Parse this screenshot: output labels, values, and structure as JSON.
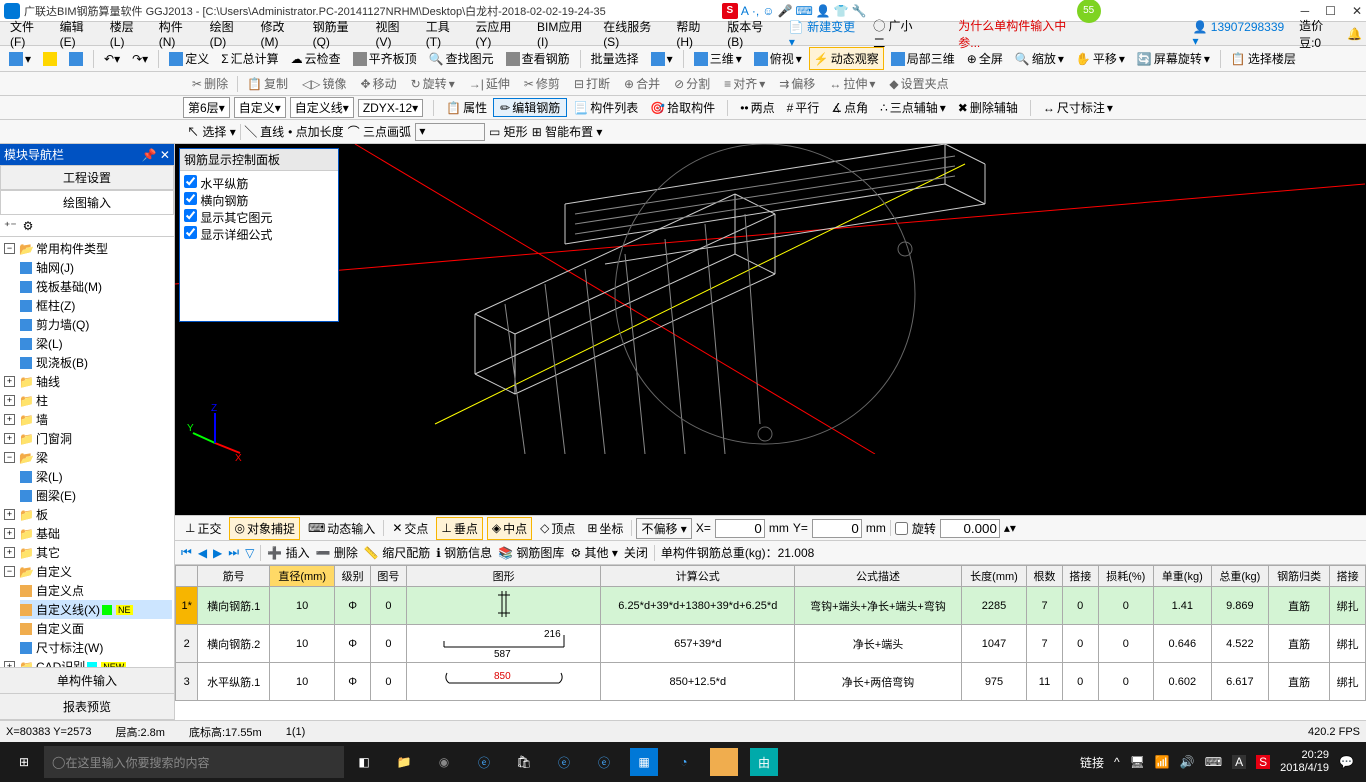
{
  "title": "广联达BIM钢筋算量软件 GGJ2013 - [C:\\Users\\Administrator.PC-20141127NRHM\\Desktop\\白龙村-2018-02-02-19-24-35",
  "green_badge": "55",
  "menubar": [
    "文件(F)",
    "编辑(E)",
    "楼层(L)",
    "构件(N)",
    "绘图(D)",
    "修改(M)",
    "钢筋量(Q)",
    "视图(V)",
    "工具(T)",
    "云应用(Y)",
    "BIM应用(I)",
    "在线服务(S)",
    "帮助(H)",
    "版本号(B)"
  ],
  "new_change": "新建变更",
  "user_toggle": "广小二",
  "warn_text": "为什么单构件输入中参...",
  "user_id": "13907298339",
  "budget_label": "造价豆:0",
  "toolbar1": {
    "define": "定义",
    "sumcalc": "汇总计算",
    "cloud": "云检查",
    "flatroof": "平齐板顶",
    "findview": "查找图元",
    "viewrebar": "查看钢筋",
    "batchsel": "批量选择",
    "threed": "三维",
    "overlook": "俯视",
    "dynview": "动态观察",
    "local3d": "局部三维",
    "fullscreen": "全屏",
    "zoom": "缩放",
    "pan": "平移",
    "screenrot": "屏幕旋转",
    "selfloor": "选择楼层"
  },
  "toolbar2": {
    "del": "删除",
    "copy": "复制",
    "mirror": "镜像",
    "move": "移动",
    "rotate": "旋转",
    "extend": "延伸",
    "trim": "修剪",
    "break": "打断",
    "merge": "合并",
    "split": "分割",
    "align": "对齐",
    "offset": "偏移",
    "stretch": "拉伸",
    "setclamp": "设置夹点"
  },
  "toolbar3": {
    "floor": "第6层",
    "custom": "自定义",
    "customline": "自定义线",
    "zdyx": "ZDYX-12",
    "props": "属性",
    "editrebar": "编辑钢筋",
    "complist": "构件列表",
    "pickcomp": "拾取构件",
    "twopoint": "两点",
    "parallel": "平行",
    "dotangle": "点角",
    "threeaux": "三点辅轴",
    "delaux": "删除辅轴",
    "dimnote": "尺寸标注"
  },
  "toolbar4": {
    "select": "选择",
    "line": "直线",
    "addlen": "点加长度",
    "threearc": "三点画弧",
    "rect": "矩形",
    "smart": "智能布置"
  },
  "sidebar": {
    "title": "模块导航栏",
    "tabs": [
      "工程设置",
      "绘图输入"
    ],
    "tree_root": "常用构件类型",
    "items": [
      "轴网(J)",
      "筏板基础(M)",
      "框柱(Z)",
      "剪力墙(Q)",
      "梁(L)",
      "现浇板(B)"
    ],
    "cats": [
      "轴线",
      "柱",
      "墙",
      "门窗洞",
      "梁",
      "板",
      "基础",
      "其它",
      "自定义",
      "CAD识别"
    ],
    "liang_sub": [
      "梁(L)",
      "圈梁(E)"
    ],
    "custom_sub": [
      "自定义点",
      "自定义线(X)",
      "自定义面",
      "尺寸标注(W)"
    ],
    "bottom": [
      "单构件输入",
      "报表预览"
    ]
  },
  "control_panel": {
    "title": "钢筋显示控制面板",
    "opts": [
      "水平纵筋",
      "横向钢筋",
      "显示其它图元",
      "显示详细公式"
    ]
  },
  "opt_toolbar": {
    "ortho": "正交",
    "objsnap": "对象捕捉",
    "dyninput": "动态输入",
    "intersect": "交点",
    "perp": "垂点",
    "mid": "中点",
    "vertex": "顶点",
    "coord": "坐标",
    "nooffset": "不偏移",
    "x": "X=",
    "xval": "0",
    "xu": "mm",
    "y": "Y=",
    "yval": "0",
    "yu": "mm",
    "rot": "旋转",
    "angle": "0.000"
  },
  "data_toolbar": {
    "insert": "插入",
    "del": "删除",
    "scale": "缩尺配筋",
    "info": "钢筋信息",
    "lib": "钢筋图库",
    "other": "其他",
    "close": "关闭",
    "total": "单构件钢筋总重(kg)：21.008"
  },
  "grid": {
    "headers": [
      "",
      "筋号",
      "直径(mm)",
      "级别",
      "图号",
      "图形",
      "计算公式",
      "公式描述",
      "长度(mm)",
      "根数",
      "搭接",
      "损耗(%)",
      "单重(kg)",
      "总重(kg)",
      "钢筋归类",
      "搭接"
    ],
    "rows": [
      {
        "n": "1*",
        "name": "横向钢筋.1",
        "dia": "10",
        "lvl": "Φ",
        "fig": "0",
        "formula": "6.25*d+39*d+1380+39*d+6.25*d",
        "desc": "弯钩+端头+净长+端头+弯钩",
        "len": "2285",
        "cnt": "7",
        "lap": "0",
        "loss": "0",
        "uw": "1.41",
        "tw": "9.869",
        "cls": "直筋",
        "lap2": "绑扎"
      },
      {
        "n": "2",
        "name": "横向钢筋.2",
        "dia": "10",
        "lvl": "Φ",
        "fig": "0",
        "formula": "657+39*d",
        "desc": "净长+端头",
        "len": "1047",
        "cnt": "7",
        "lap": "0",
        "loss": "0",
        "uw": "0.646",
        "tw": "4.522",
        "cls": "直筋",
        "lap2": "绑扎",
        "shape": {
          "l": "587",
          "r": "216"
        }
      },
      {
        "n": "3",
        "name": "水平纵筋.1",
        "dia": "10",
        "lvl": "Φ",
        "fig": "0",
        "formula": "850+12.5*d",
        "desc": "净长+两倍弯钩",
        "len": "975",
        "cnt": "11",
        "lap": "0",
        "loss": "0",
        "uw": "0.602",
        "tw": "6.617",
        "cls": "直筋",
        "lap2": "绑扎",
        "shape": {
          "c": "850"
        }
      }
    ]
  },
  "statusbar": {
    "coord": "X=80383 Y=2573",
    "floorh": "层高:2.8m",
    "baseh": "底标高:17.55m",
    "one": "1(1)",
    "fps": "420.2 FPS"
  },
  "taskbar": {
    "search": "在这里输入你要搜索的内容",
    "link": "链接",
    "time": "20:29",
    "date": "2018/4/19"
  }
}
